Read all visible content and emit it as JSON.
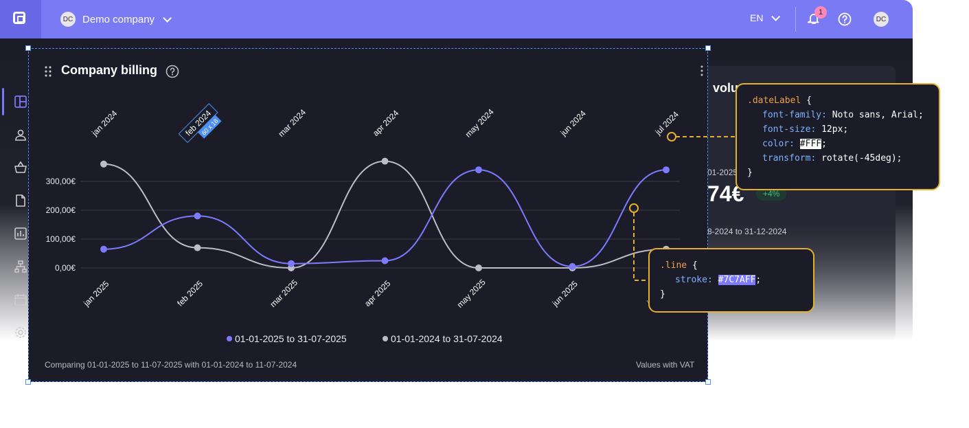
{
  "topbar": {
    "company_initials": "DC",
    "company_name": "Demo company",
    "language": "EN",
    "notification_count": "1",
    "user_initials": "DC"
  },
  "background_card": {
    "title": "volu",
    "date_range_partial": "01-2025",
    "amount": "74€",
    "change": "+4%",
    "comparison_partial": "8-2024 to 31-12-2024"
  },
  "widget": {
    "title": "Company billing",
    "footer_left": "Comparing 01-01-2025 to 11-07-2025 with 01-01-2024 to 11-07-2024",
    "footer_right": "Values with VAT",
    "selection_label": "60 x 18"
  },
  "chart_data": {
    "type": "line",
    "top_categories": [
      "jan 2024",
      "feb 2024",
      "mar 2024",
      "apr 2024",
      "may 2024",
      "jun 2024",
      "jul 2024"
    ],
    "categories": [
      "jan 2025",
      "feb 2025",
      "mar 2025",
      "apr 2025",
      "may 2025",
      "jun 2025",
      "jul 2025"
    ],
    "y_ticks": [
      "0,00€",
      "100,00€",
      "200,00€",
      "300,00€"
    ],
    "ylim": [
      0,
      330
    ],
    "grid": true,
    "legend_position": "bottom",
    "series": [
      {
        "name": "01-01-2025 to 31-07-2025",
        "color": "#7C7AFF",
        "values": [
          65,
          180,
          15,
          25,
          340,
          5,
          340
        ]
      },
      {
        "name": "01-01-2024 to 31-07-2024",
        "color": "#BDBDC8",
        "values": [
          360,
          70,
          0,
          370,
          0,
          0,
          65
        ]
      }
    ]
  },
  "tooltips": {
    "date_label": {
      "selector": ".dateLabel",
      "lines": [
        {
          "prop": "font-family:",
          "value": " Noto sans, Arial;"
        },
        {
          "prop": "font-size:",
          "value": " 12px;"
        },
        {
          "prop": "color:",
          "value": "#FFF"
        },
        {
          "prop": "transform:",
          "value": " rotate(-45deg);"
        }
      ]
    },
    "line": {
      "selector": ".line",
      "prop": "stroke:",
      "value": "#7C7AFF"
    }
  },
  "colors": {
    "accent": "#7b7af5",
    "tooltip_border": "#e6b12a",
    "selection": "#4d8ff2"
  }
}
